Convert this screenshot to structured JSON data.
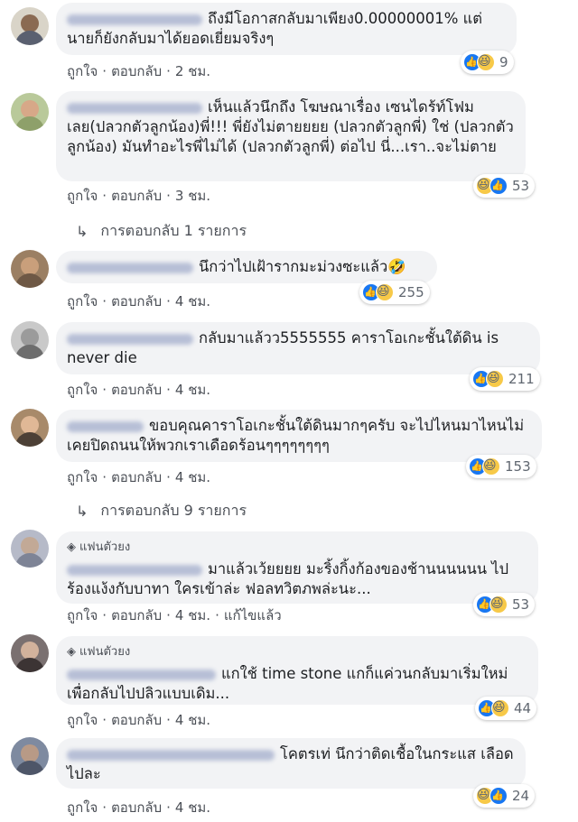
{
  "actions": {
    "like": "ถูกใจ",
    "reply": "ตอบกลับ",
    "edited": "แก้ไขแล้ว"
  },
  "comments": [
    {
      "text": "ถึงมีโอกาสกลับมาเพียง0.00000001% แต่นายก็ยังกลับมาได้ยอดเยี่ยมจริงๆ",
      "time": "2 ชม.",
      "reactions": [
        "like",
        "haha"
      ],
      "count": "9",
      "fan_badge": ""
    },
    {
      "text": "เห็นแล้วนึกถึง โฆษณาเรื่อง เซนไดร้ท์โฟม เลย(ปลวกตัวลูกน้อง)พี่!!! พี่ยังไม่ตายยยย (ปลวกตัวลูกพี่) ใช่ (ปลวกตัวลูกน้อง) มันทำอะไรพี่ไม่ได้ (ปลวกตัวลูกพี่) ต่อไป นี่...เรา..จะไม่ตาย",
      "time": "3 ชม.",
      "reactions": [
        "haha",
        "like"
      ],
      "count": "53",
      "fan_badge": ""
    },
    {
      "text": "นึกว่าไปเฝ้ารากมะม่วงซะแล้ว🤣",
      "time": "4 ชม.",
      "reactions": [
        "like",
        "haha"
      ],
      "count": "255",
      "fan_badge": ""
    },
    {
      "text": "กลับมาแล้วว5555555 คาราโอเกะชั้นใต้ดิน is never die",
      "time": "4 ชม.",
      "reactions": [
        "like",
        "haha"
      ],
      "count": "211",
      "fan_badge": ""
    },
    {
      "text": "ขอบคุณคาราโอเกะชั้นใต้ดินมากๆครับ จะไปไหนมาไหนไม่เคยปิดถนนให้พวกเราเดือดร้อนๆๆๆๆๆๆๆๆ",
      "time": "4 ชม.",
      "reactions": [
        "like",
        "haha"
      ],
      "count": "153",
      "fan_badge": ""
    },
    {
      "text": "มาแล้วเว้ยยยย มะริ้งกิ้งก้องของช้านนนนนน ไปร้องแง้งกับบาทา ใครเข้าล่ะ ฟอลทวิตภพล่ะนะ...",
      "time": "4 ชม.",
      "reactions": [
        "like",
        "haha"
      ],
      "count": "53",
      "fan_badge": "แฟนตัวยง",
      "edited": true
    },
    {
      "text": "แกใช้ time stone แกก็แค่วนกลับมาเริ่มใหม่เพื่อกลับไปปลิวแบบเดิม...",
      "time": "4 ชม.",
      "reactions": [
        "like",
        "haha"
      ],
      "count": "44",
      "fan_badge": "แฟนตัวยง"
    },
    {
      "text": "โคตรเท่ นึกว่าติดเชื้อในกระแส เลือดไปละ",
      "time": "4 ชม.",
      "reactions": [
        "haha",
        "like"
      ],
      "count": "24",
      "fan_badge": ""
    }
  ],
  "replies": [
    {
      "label": "การตอบกลับ 1 รายการ"
    },
    {
      "label": "การตอบกลับ 9 รายการ"
    }
  ],
  "colors": {
    "bubble": "#f2f3f5",
    "link": "#4b4f56",
    "like": "#1877f2",
    "haha": "#f7c948"
  }
}
